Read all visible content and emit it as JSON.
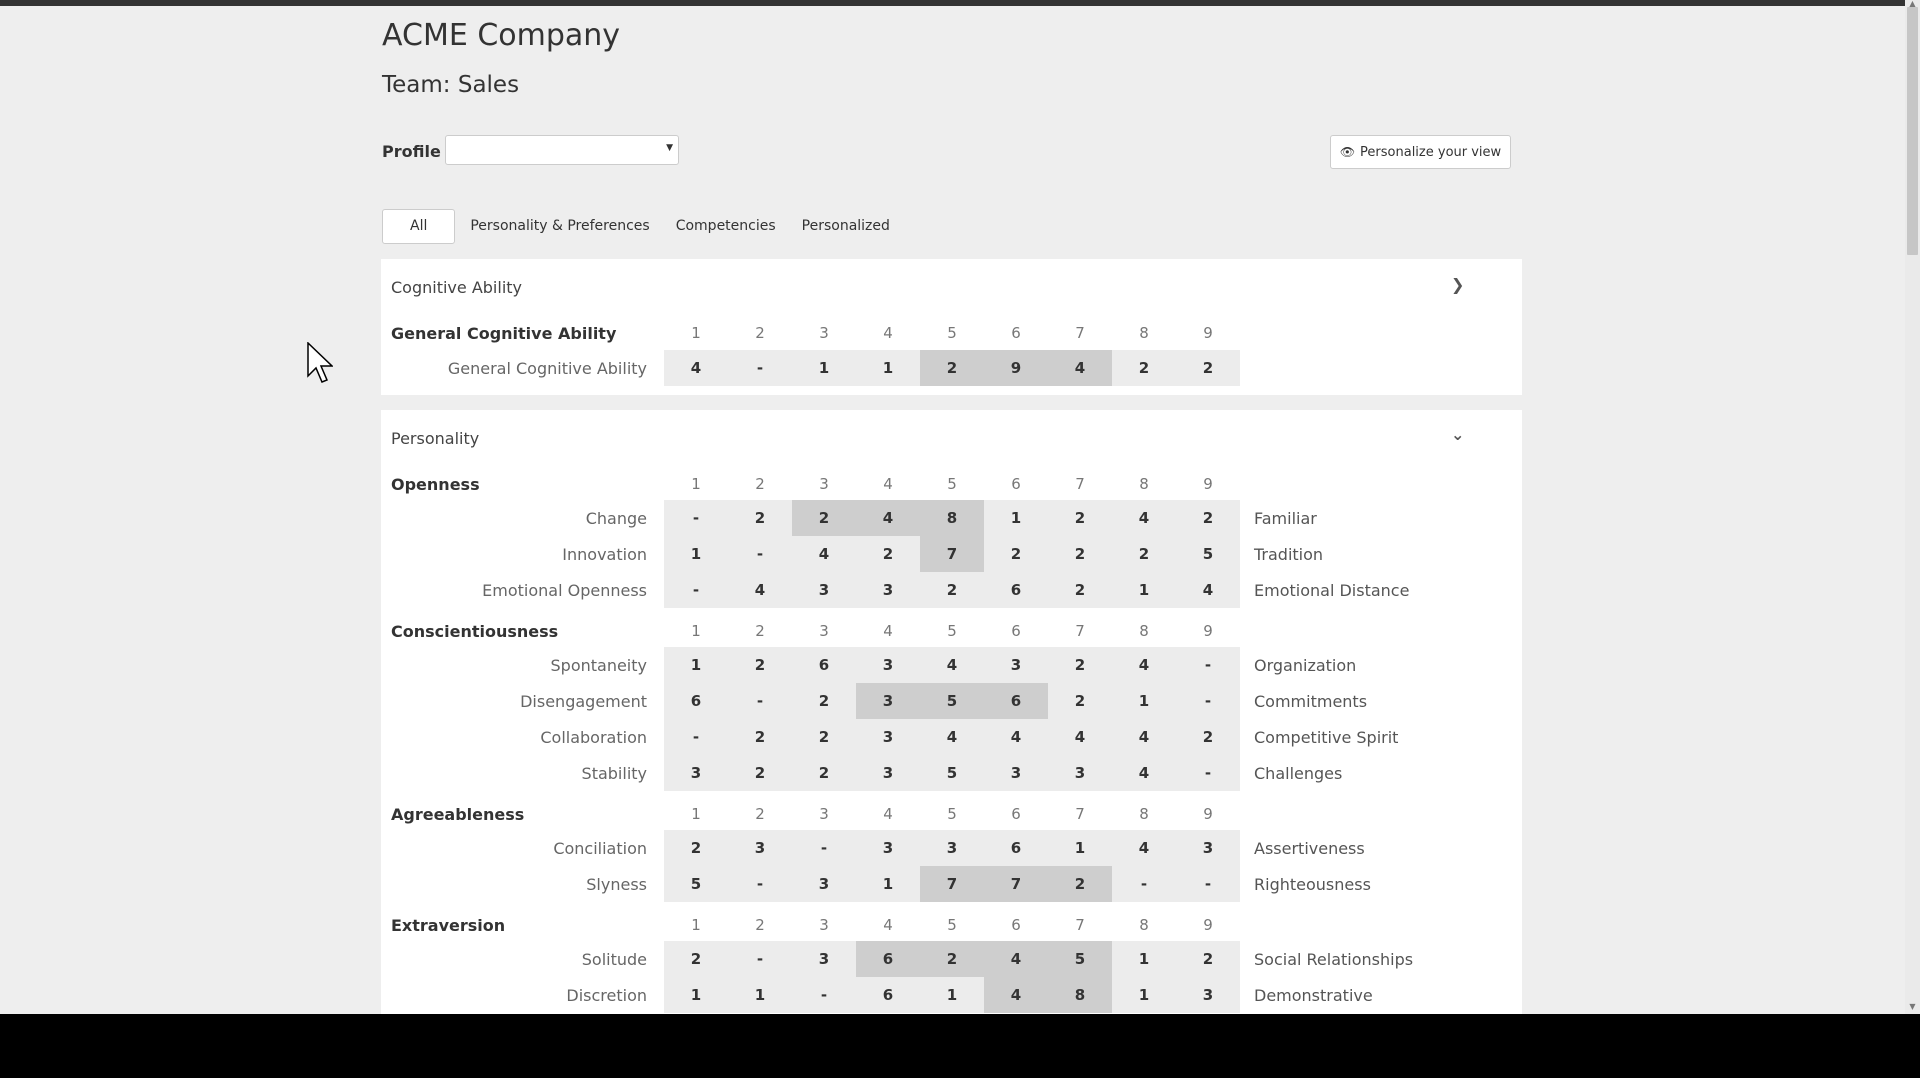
{
  "page": {
    "company": "ACME Company",
    "team": "Team: Sales",
    "profile_label": "Profile :",
    "profile_value": "",
    "personalize_label": "Personalize your view"
  },
  "tabs": [
    "All",
    "Personality & Preferences",
    "Competencies",
    "Personalized"
  ],
  "score_columns": [
    "1",
    "2",
    "3",
    "4",
    "5",
    "6",
    "7",
    "8",
    "9"
  ],
  "sections": {
    "cognitive": {
      "title": "Cognitive Ability",
      "group": "General Cognitive Ability",
      "rows": [
        {
          "label": "General Cognitive Ability",
          "right": "",
          "values": [
            "4",
            "-",
            "1",
            "1",
            "2",
            "9",
            "4",
            "2",
            "2"
          ],
          "highlight": [
            4,
            5,
            6
          ]
        }
      ]
    },
    "personality": {
      "title": "Personality",
      "groups": [
        {
          "name": "Openness",
          "rows": [
            {
              "label": "Change",
              "right": "Familiar",
              "values": [
                "-",
                "2",
                "2",
                "4",
                "8",
                "1",
                "2",
                "4",
                "2"
              ],
              "highlight": [
                2,
                3,
                4
              ]
            },
            {
              "label": "Innovation",
              "right": "Tradition",
              "values": [
                "1",
                "-",
                "4",
                "2",
                "7",
                "2",
                "2",
                "2",
                "5"
              ],
              "highlight": [
                4
              ]
            },
            {
              "label": "Emotional Openness",
              "right": "Emotional Distance",
              "values": [
                "-",
                "4",
                "3",
                "3",
                "2",
                "6",
                "2",
                "1",
                "4"
              ],
              "highlight": []
            }
          ]
        },
        {
          "name": "Conscientiousness",
          "rows": [
            {
              "label": "Spontaneity",
              "right": "Organization",
              "values": [
                "1",
                "2",
                "6",
                "3",
                "4",
                "3",
                "2",
                "4",
                "-"
              ],
              "highlight": []
            },
            {
              "label": "Disengagement",
              "right": "Commitments",
              "values": [
                "6",
                "-",
                "2",
                "3",
                "5",
                "6",
                "2",
                "1",
                "-"
              ],
              "highlight": [
                3,
                4,
                5
              ]
            },
            {
              "label": "Collaboration",
              "right": "Competitive Spirit",
              "values": [
                "-",
                "2",
                "2",
                "3",
                "4",
                "4",
                "4",
                "4",
                "2"
              ],
              "highlight": []
            },
            {
              "label": "Stability",
              "right": "Challenges",
              "values": [
                "3",
                "2",
                "2",
                "3",
                "5",
                "3",
                "3",
                "4",
                "-"
              ],
              "highlight": []
            }
          ]
        },
        {
          "name": "Agreeableness",
          "rows": [
            {
              "label": "Conciliation",
              "right": "Assertiveness",
              "values": [
                "2",
                "3",
                "-",
                "3",
                "3",
                "6",
                "1",
                "4",
                "3"
              ],
              "highlight": []
            },
            {
              "label": "Slyness",
              "right": "Righteousness",
              "values": [
                "5",
                "-",
                "3",
                "1",
                "7",
                "7",
                "2",
                "-",
                "-"
              ],
              "highlight": [
                4,
                5,
                6
              ]
            }
          ]
        },
        {
          "name": "Extraversion",
          "rows": [
            {
              "label": "Solitude",
              "right": "Social Relationships",
              "values": [
                "2",
                "-",
                "3",
                "6",
                "2",
                "4",
                "5",
                "1",
                "2"
              ],
              "highlight": [
                3,
                4,
                5,
                6
              ]
            },
            {
              "label": "Discretion",
              "right": "Demonstrative",
              "values": [
                "1",
                "1",
                "-",
                "6",
                "1",
                "4",
                "8",
                "1",
                "3"
              ],
              "highlight": [
                5,
                6
              ]
            }
          ]
        }
      ]
    }
  }
}
